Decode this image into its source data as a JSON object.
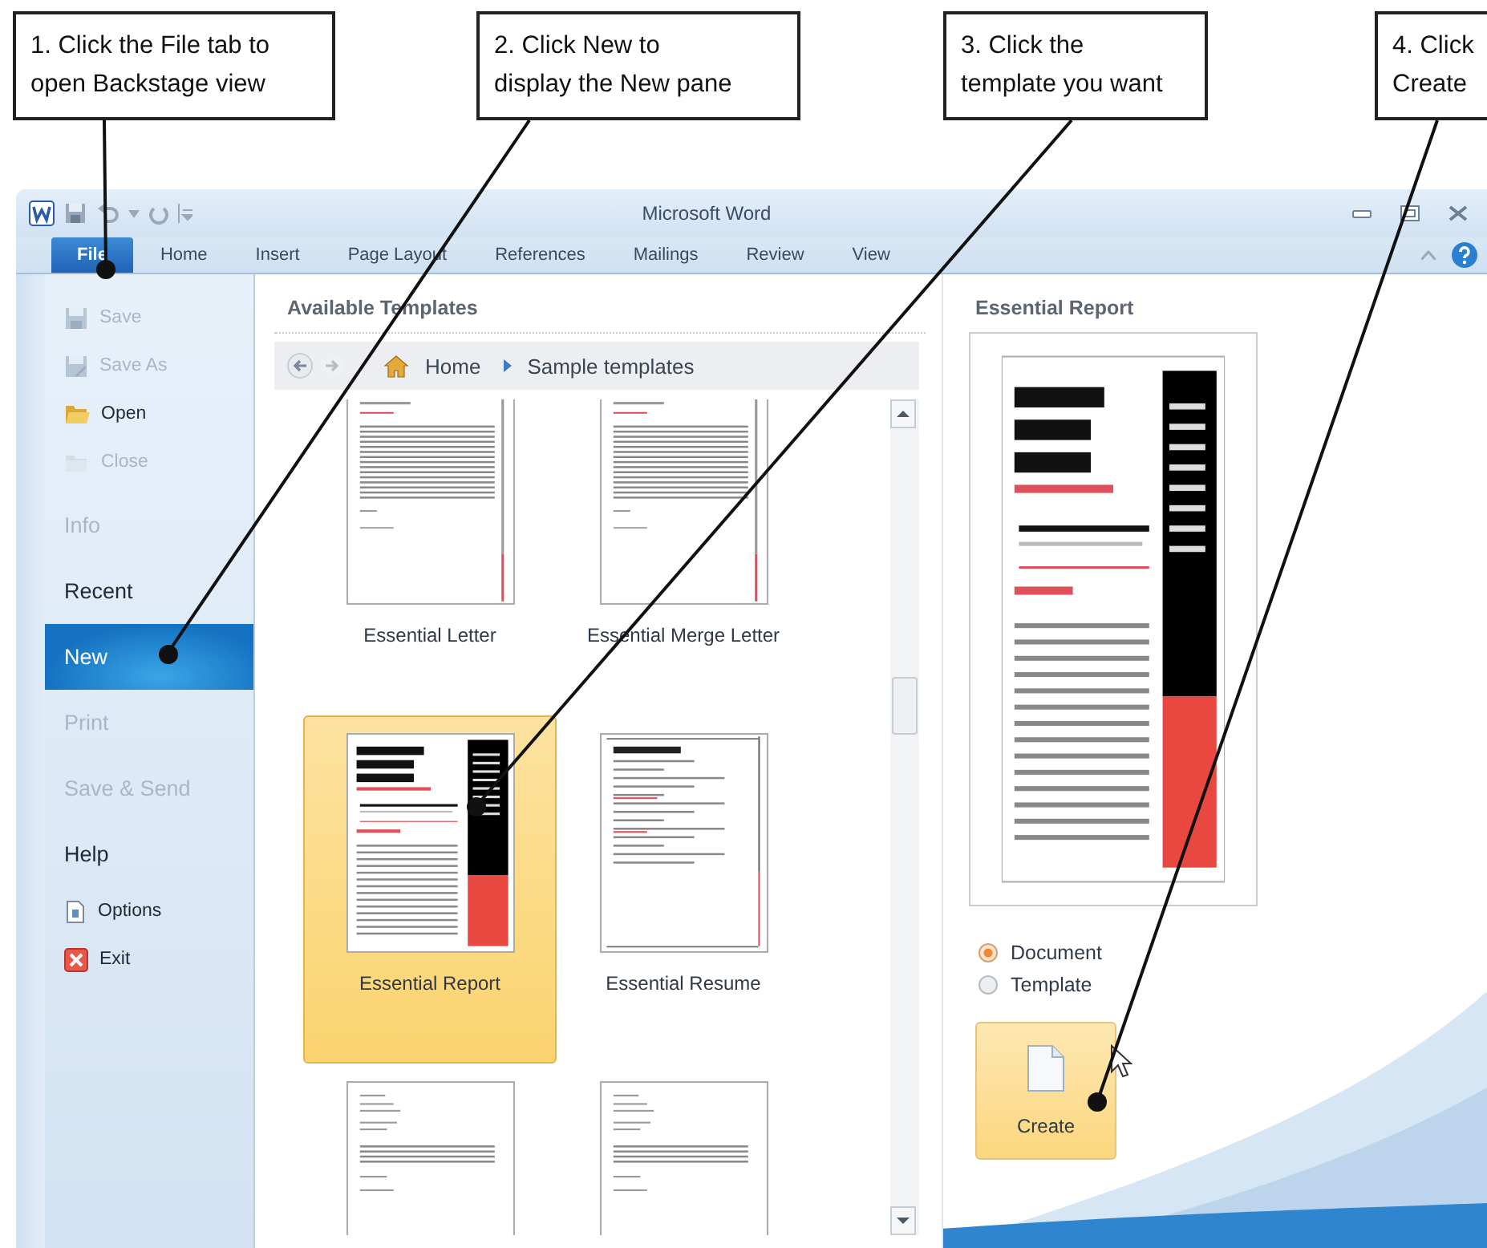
{
  "callouts": [
    {
      "text": "1. Click the File tab to\nopen Backstage view"
    },
    {
      "text": "2. Click New to\ndisplay the New pane"
    },
    {
      "text": "3. Click the\ntemplate you want"
    },
    {
      "text": "4. Click\nCreate"
    }
  ],
  "window": {
    "title": "Microsoft Word"
  },
  "tabs": [
    {
      "label": "File",
      "selected": true
    },
    {
      "label": "Home",
      "selected": false
    },
    {
      "label": "Insert",
      "selected": false
    },
    {
      "label": "Page Layout",
      "selected": false
    },
    {
      "label": "References",
      "selected": false
    },
    {
      "label": "Mailings",
      "selected": false
    },
    {
      "label": "Review",
      "selected": false
    },
    {
      "label": "View",
      "selected": false
    }
  ],
  "sidebar": {
    "items": [
      {
        "kind": "command",
        "label": "Save",
        "disabled": true,
        "selected": false
      },
      {
        "kind": "command",
        "label": "Save As",
        "disabled": true,
        "selected": false
      },
      {
        "kind": "command",
        "label": "Open",
        "disabled": false,
        "selected": false
      },
      {
        "kind": "command",
        "label": "Close",
        "disabled": true,
        "selected": false
      },
      {
        "kind": "section",
        "label": "Info",
        "disabled": true,
        "selected": false
      },
      {
        "kind": "section",
        "label": "Recent",
        "disabled": false,
        "selected": false
      },
      {
        "kind": "section",
        "label": "New",
        "disabled": false,
        "selected": true
      },
      {
        "kind": "section",
        "label": "Print",
        "disabled": true,
        "selected": false
      },
      {
        "kind": "section",
        "label": "Save & Send",
        "disabled": true,
        "selected": false
      },
      {
        "kind": "section",
        "label": "Help",
        "disabled": false,
        "selected": false
      },
      {
        "kind": "command",
        "label": "Options",
        "disabled": false,
        "selected": false
      },
      {
        "kind": "command",
        "label": "Exit",
        "disabled": false,
        "selected": false
      }
    ]
  },
  "templates_pane": {
    "heading": "Available Templates",
    "breadcrumb": [
      {
        "label": "Home"
      },
      {
        "label": "Sample templates"
      }
    ],
    "templates": [
      {
        "kind": "letter",
        "name": "Essential Letter",
        "selected": false
      },
      {
        "kind": "letter",
        "name": "Essential Merge Letter",
        "selected": false
      },
      {
        "kind": "report",
        "name": "Essential Report",
        "selected": true
      },
      {
        "kind": "resume",
        "name": "Essential Resume",
        "selected": false
      },
      {
        "kind": "plain",
        "selected": false
      },
      {
        "kind": "plain",
        "selected": false
      }
    ]
  },
  "preview_pane": {
    "title": "Essential Report",
    "options": [
      {
        "label": "Document",
        "selected": true
      },
      {
        "label": "Template",
        "selected": false
      }
    ],
    "create_button": "Create"
  }
}
